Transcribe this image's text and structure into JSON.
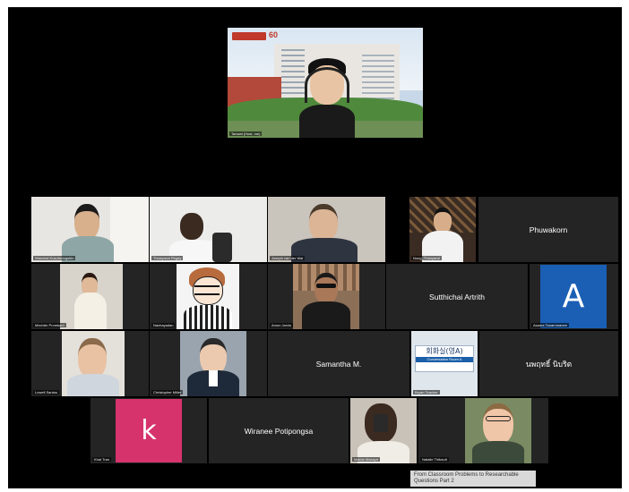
{
  "host": {
    "name": "Tanwat (Host, me)",
    "logo_text": "60"
  },
  "participants": [
    {
      "id": "p1",
      "name": "Wanchai Kusolwongsirin",
      "video": true
    },
    {
      "id": "p2",
      "name": "Thompson Pegay",
      "video": true
    },
    {
      "id": "p3",
      "name": "Joseph van der Wal",
      "video": true
    },
    {
      "id": "p4",
      "name": "Nong_Thanyarat",
      "video": true
    },
    {
      "id": "p5",
      "name": "Phuwakorn",
      "video": false
    },
    {
      "id": "p6",
      "name": "Mechter Promkam",
      "video": true
    },
    {
      "id": "p7",
      "name": "Nachayadan",
      "video": true
    },
    {
      "id": "p8",
      "name": "Amon Jarvis",
      "video": true
    },
    {
      "id": "p9",
      "name": "Sutthichai Artrith",
      "video": false
    },
    {
      "id": "p10",
      "name": "Asama Tanarnmanee",
      "video": false,
      "avatar_letter": "A",
      "avatar_color": "#1a5fb4"
    },
    {
      "id": "p11",
      "name": "Lowell Santos",
      "video": true
    },
    {
      "id": "p12",
      "name": "Christopher Miller",
      "video": true
    },
    {
      "id": "p13",
      "name": "Samantha M.",
      "video": false
    },
    {
      "id": "p14",
      "name": "Bryan Teacher",
      "video": true,
      "sign_line1": "회화실(영A)",
      "sign_line2": "Conversation Room A"
    },
    {
      "id": "p15",
      "name": "นพฤทธิ์ นิบริต",
      "video": false
    },
    {
      "id": "p16",
      "name": "Khai Tran",
      "video": false,
      "avatar_letter": "k",
      "avatar_color": "#d6336c"
    },
    {
      "id": "p17",
      "name": "Wiranee Potipongsa",
      "video": false
    },
    {
      "id": "p18",
      "name": "Malida Masaya",
      "video": true
    },
    {
      "id": "p19",
      "name": "Natalie Thibault",
      "video": true
    }
  ],
  "caption": "From Classroom Problems to Researchable Questions Part 2",
  "colors": {
    "meeting_bg": "#000000",
    "tile_bg": "#242424",
    "caption_bg": "#d9d9d9"
  }
}
